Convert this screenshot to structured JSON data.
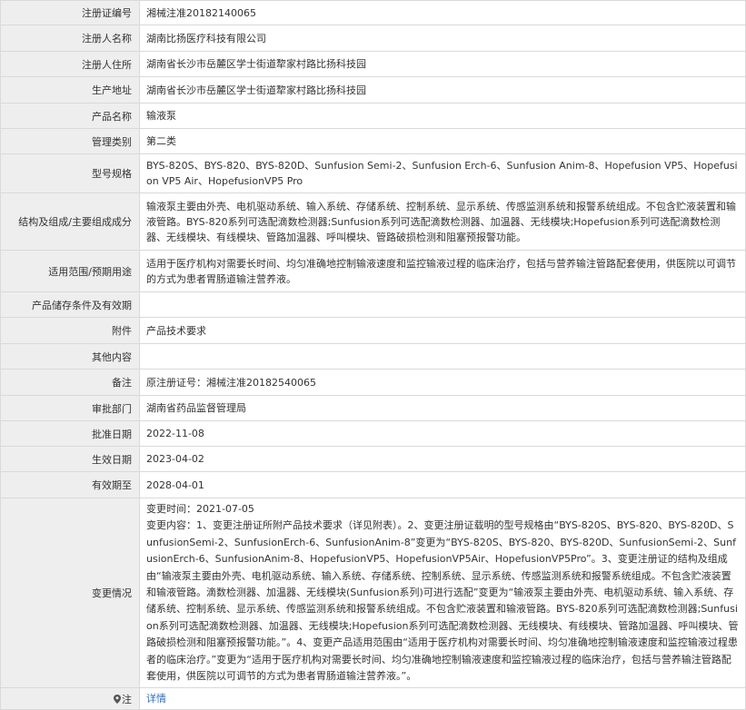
{
  "rows": [
    {
      "label": "注册证编号",
      "value": "湘械注准20182140065"
    },
    {
      "label": "注册人名称",
      "value": "湖南比扬医疗科技有限公司"
    },
    {
      "label": "注册人住所",
      "value": "湖南省长沙市岳麓区学士街道犂家村路比扬科技园"
    },
    {
      "label": "生产地址",
      "value": "湖南省长沙市岳麓区学士街道犂家村路比扬科技园"
    },
    {
      "label": "产品名称",
      "value": "输液泵"
    },
    {
      "label": "管理类别",
      "value": "第二类"
    },
    {
      "label": "型号规格",
      "value": "BYS-820S、BYS-820、BYS-820D、Sunfusion Semi-2、Sunfusion Erch-6、Sunfusion Anim-8、Hopefusion VP5、Hopefusion VP5 Air、HopefusionVP5 Pro"
    },
    {
      "label": "结构及组成/主要组成成分",
      "value": "输液泵主要由外壳、电机驱动系统、输入系统、存储系统、控制系统、显示系统、传感监测系统和报警系统组成。不包含贮液装置和输液管路。BYS-820系列可选配滴数检测器;Sunfusion系列可选配滴数检测器、加温器、无线模块;Hopefusion系列可选配滴数检测器、无线模块、有线模块、管路加温器、呼叫模块、管路破损检测和阻塞预报警功能。"
    },
    {
      "label": "适用范围/预期用途",
      "value": "适用于医疗机构对需要长时间、均匀准确地控制输液速度和监控输液过程的临床治疗，包括与营养输注管路配套使用，供医院以可调节的方式为患者胃肠道输注营养液。"
    },
    {
      "label": "产品储存条件及有效期",
      "value": ""
    },
    {
      "label": "附件",
      "value": "产品技术要求"
    },
    {
      "label": "其他内容",
      "value": ""
    },
    {
      "label": "备注",
      "value": "原注册证号：湘械注准20182540065"
    },
    {
      "label": "审批部门",
      "value": "湖南省药品监督管理局"
    },
    {
      "label": "批准日期",
      "value": "2022-11-08"
    },
    {
      "label": "生效日期",
      "value": "2023-04-02"
    },
    {
      "label": "有效期至",
      "value": "2028-04-01"
    }
  ],
  "change": {
    "label": "变更情况",
    "time": "变更时间：2021-07-05",
    "content": "变更内容：1、变更注册证所附产品技术要求（详见附表）。2、变更注册证载明的型号规格由“BYS-820S、BYS-820、BYS-820D、SunfusionSemi-2、SunfusionErch-6、SunfusionAnim-8”变更为“BYS-820S、BYS-820、BYS-820D、SunfusionSemi-2、SunfusionErch-6、SunfusionAnim-8、HopefusionVP5、HopefusionVP5Air、HopefusionVP5Pro”。3、变更注册证的结构及组成由“输液泵主要由外壳、电机驱动系统、输入系统、存储系统、控制系统、显示系统、传感监测系统和报警系统组成。不包含贮液装置和输液管路。滴数检测器、加温器、无线模块(Sunfusion系列)可进行选配”变更为“输液泵主要由外壳、电机驱动系统、输入系统、存储系统、控制系统、显示系统、传感监测系统和报警系统组成。不包含贮液装置和输液管路。BYS-820系列可选配滴数检测器;Sunfusion系列可选配滴数检测器、加温器、无线模块;Hopefusion系列可选配滴数检测器、无线模块、有线模块、管路加温器、呼叫模块、管路破损检测和阻塞预报警功能。”。4、变更产品适用范围由“适用于医疗机构对需要长时间、均匀准确地控制输液速度和监控输液过程患者的临床治疗。”变更为“适用于医疗机构对需要长时间、均匀准确地控制输液速度和监控输液过程的临床治疗，包括与营养输注管路配套使用，供医院以可调节的方式为患者胃肠道输注营养液。”。"
  },
  "note": {
    "label": "注",
    "link_text": "详情"
  },
  "colors": {
    "label_bg": "#eeeeee",
    "border": "#d9d9d9",
    "link": "#2a6fbf"
  }
}
